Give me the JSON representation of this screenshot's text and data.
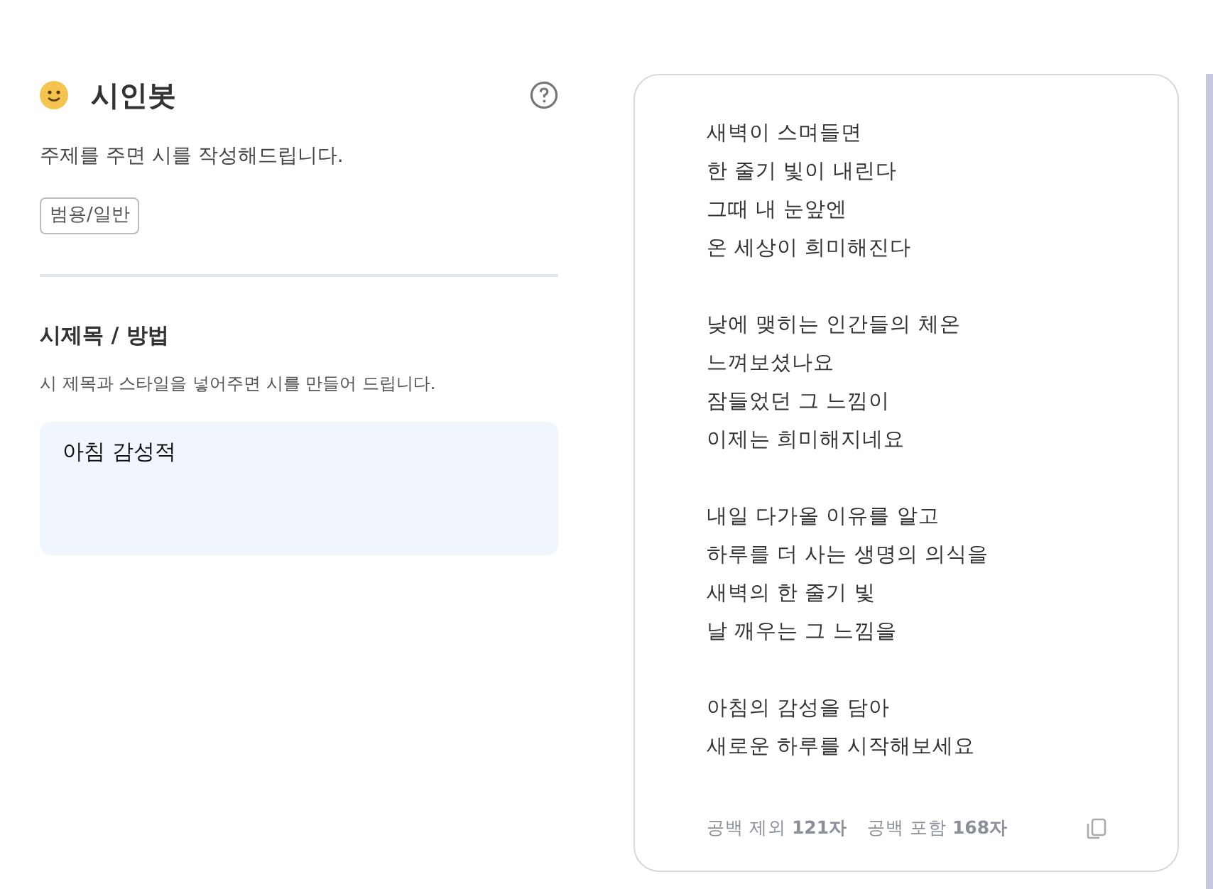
{
  "header": {
    "title": "시인봇",
    "description": "주제를 주면 시를 작성해드립니다.",
    "tag": "범용/일반"
  },
  "section": {
    "title": "시제목 / 방법",
    "hint": "시 제목과 스타일을 넣어주면 시를 만들어 드립니다.",
    "value": "아침 감성적"
  },
  "poem": {
    "stanzas": [
      [
        "새벽이 스며들면",
        "한 줄기 빛이 내린다",
        "그때 내 눈앞엔",
        "온 세상이 희미해진다"
      ],
      [
        "낮에 맺히는 인간들의 체온",
        "느껴보셨나요",
        "잠들었던 그 느낌이",
        "이제는 희미해지네요"
      ],
      [
        "내일 다가올 이유를 알고",
        "하루를 더 사는 생명의 의식을",
        "새벽의 한 줄기 빛",
        "날 깨우는 그 느낌을"
      ],
      [
        "아침의 감성을 담아",
        "새로운 하루를 시작해보세요"
      ]
    ],
    "counts": [
      "공백 제외 **121자**",
      "공백 포함 **168자**"
    ]
  }
}
